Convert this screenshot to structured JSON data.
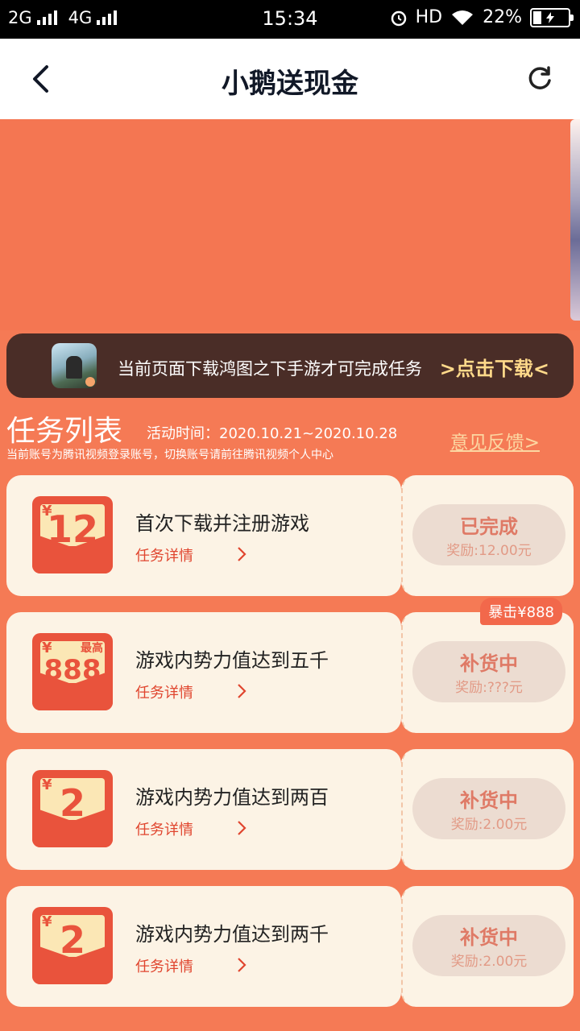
{
  "status_bar": {
    "network1": "2G",
    "network2": "4G",
    "time": "15:34",
    "hd": "HD",
    "battery": "22%"
  },
  "nav": {
    "title": "小鹅送现金"
  },
  "download_bar": {
    "text": "当前页面下载鸿图之下手游才可完成任务",
    "link": ">点击下载<"
  },
  "task_list": {
    "title": "任务列表",
    "activity_time": "活动时间：2020.10.21~2020.10.28",
    "feedback": "意见反馈>",
    "account_note": "当前账号为腾讯视频登录账号，切换账号请前往腾讯视频个人中心",
    "yen_symbol": "¥",
    "max_label": "最高",
    "detail_label": "任务详情",
    "tasks": [
      {
        "amount": "12",
        "name": "首次下载并注册游戏",
        "status": "已完成",
        "reward": "奖励:12.00元",
        "badge": ""
      },
      {
        "amount": "888",
        "name": "游戏内势力值达到五千",
        "status": "补货中",
        "reward": "奖励:???元",
        "badge": "暴击¥888"
      },
      {
        "amount": "2",
        "name": "游戏内势力值达到两百",
        "status": "补货中",
        "reward": "奖励:2.00元",
        "badge": ""
      },
      {
        "amount": "2",
        "name": "游戏内势力值达到两千",
        "status": "补货中",
        "reward": "奖励:2.00元",
        "badge": ""
      }
    ]
  }
}
